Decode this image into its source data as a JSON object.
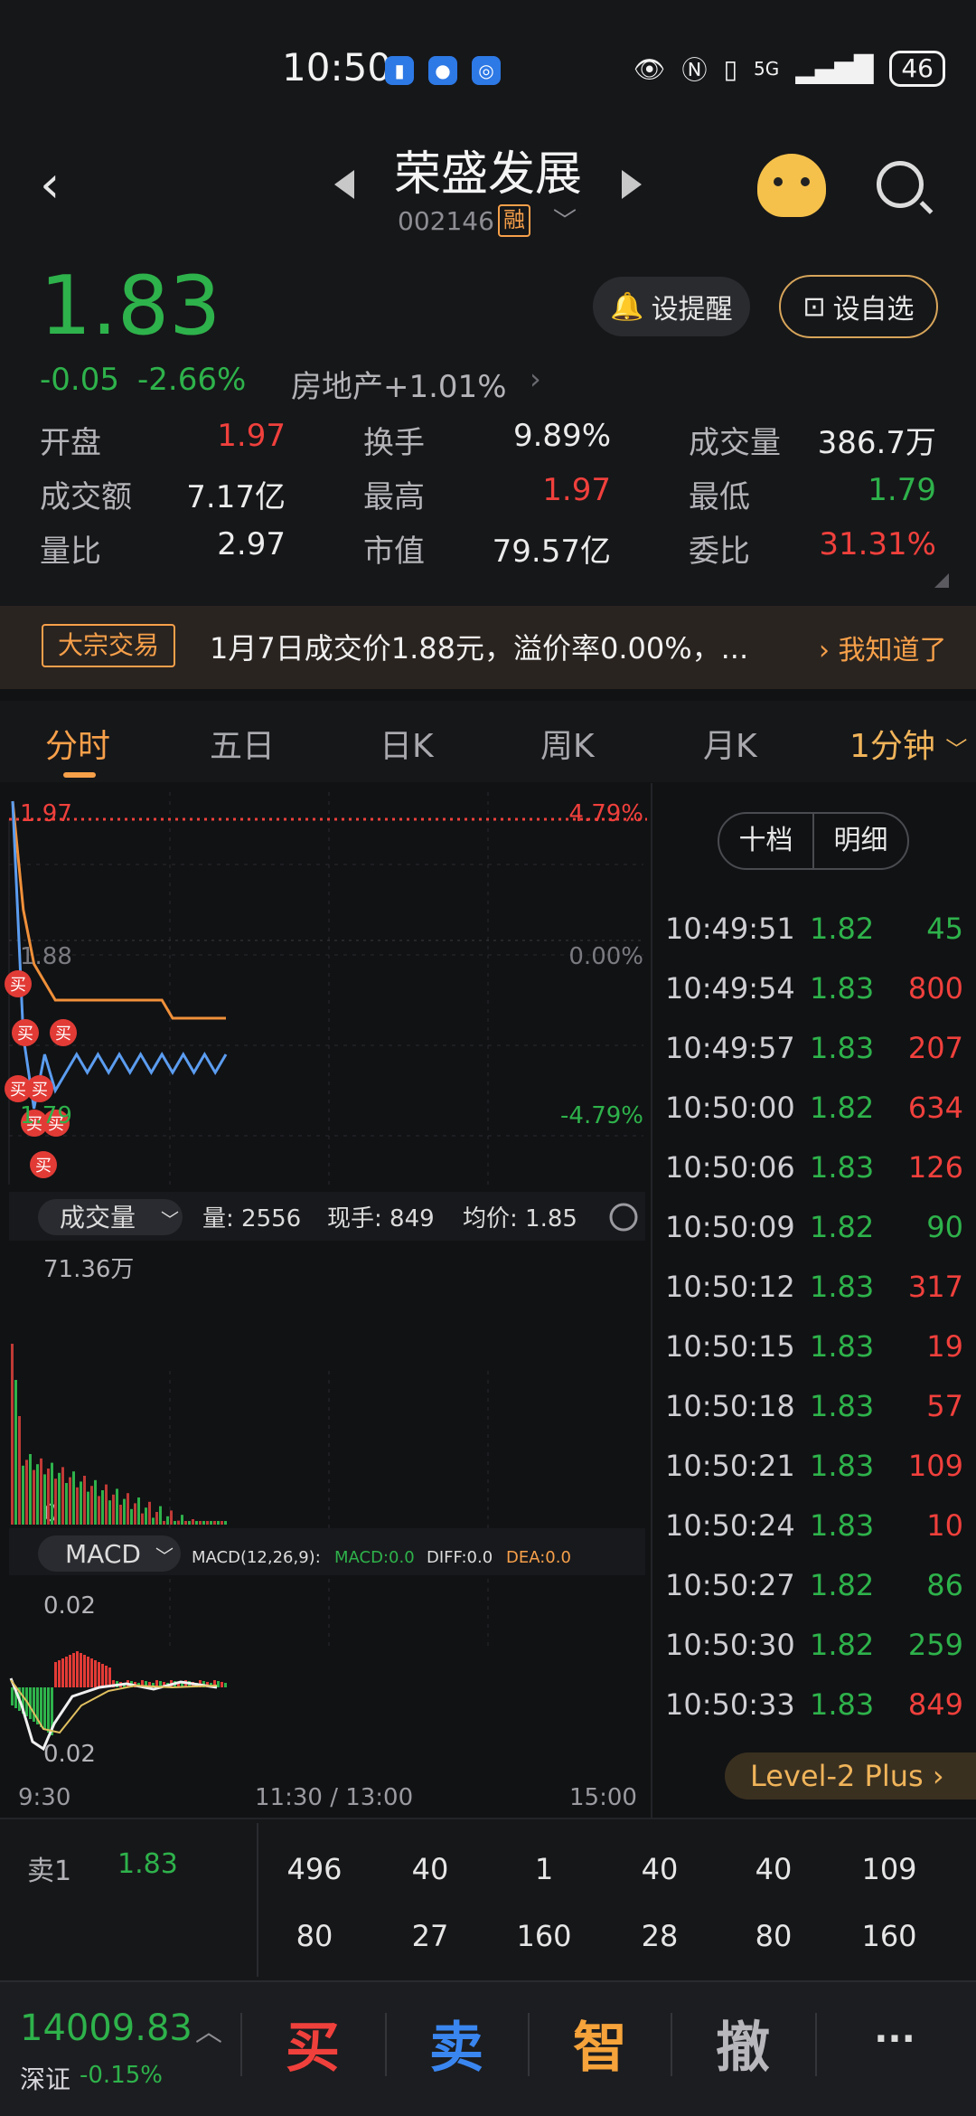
{
  "status_bar": {
    "time": "10:50",
    "network": "5G",
    "battery": "46"
  },
  "header": {
    "stock_name": "荣盛发展",
    "stock_code": "002146",
    "margin_badge": "融"
  },
  "quote": {
    "price": "1.83",
    "change": "-0.05",
    "change_pct": "-2.66%",
    "sector": "房地产+1.01%",
    "alert_label": "设提醒",
    "watchlist_label": "设自选",
    "stats": [
      {
        "label": "开盘",
        "value": "1.97",
        "color": "#f0403c"
      },
      {
        "label": "换手",
        "value": "9.89%",
        "color": "#ececec"
      },
      {
        "label": "成交量",
        "value": "386.7万",
        "color": "#ececec"
      },
      {
        "label": "成交额",
        "value": "7.17亿",
        "color": "#ececec"
      },
      {
        "label": "最高",
        "value": "1.97",
        "color": "#f0403c"
      },
      {
        "label": "最低",
        "value": "1.79",
        "color": "#2eb24b"
      },
      {
        "label": "量比",
        "value": "2.97",
        "color": "#ececec"
      },
      {
        "label": "市值",
        "value": "79.57亿",
        "color": "#ececec"
      },
      {
        "label": "委比",
        "value": "31.31%",
        "color": "#f0403c"
      }
    ]
  },
  "banner": {
    "tag": "大宗交易",
    "text": "1月7日成交价1.88元，溢价率0.00%，...",
    "ack": "我知道了"
  },
  "tabs": [
    {
      "label": "分时",
      "active": true
    },
    {
      "label": "五日"
    },
    {
      "label": "日K"
    },
    {
      "label": "周K"
    },
    {
      "label": "月K"
    },
    {
      "label": "1分钟"
    }
  ],
  "chart": {
    "price_high": "1.97",
    "price_mid": "1.88",
    "price_low": "1.79",
    "pct_high": "4.79%",
    "pct_mid": "0.00%",
    "pct_low": "-4.79%",
    "volume_selector": "成交量",
    "volume_info": {
      "vol": "量: 2556",
      "current": "现手: 849",
      "avg": "均价: 1.85"
    },
    "volume_max": "71.36万",
    "volume_zero": "0",
    "macd_selector": "MACD",
    "macd_params": "MACD(12,26,9):",
    "macd_value": "MACD:0.0",
    "diff_value": "DIFF:0.0",
    "dea_value": "DEA:0.0",
    "macd_top": "0.02",
    "macd_bottom": "0.02",
    "time_labels": [
      "9:30",
      "11:30 / 13:00",
      "15:00"
    ],
    "buy_marker": "买"
  },
  "chart_data": {
    "type": "line",
    "title": "",
    "x": [
      0,
      1,
      2,
      3,
      4,
      5,
      6,
      7,
      8,
      9,
      10,
      11,
      12,
      13,
      14,
      15,
      16,
      17,
      18,
      19,
      20
    ],
    "ylim": [
      1.79,
      1.97
    ],
    "series": [
      {
        "values": [
          1.97,
          1.84,
          1.8,
          1.83,
          1.81,
          1.82,
          1.83,
          1.82,
          1.83,
          1.82,
          1.83,
          1.82,
          1.83,
          1.82,
          1.83,
          1.82,
          1.83,
          1.82,
          1.83,
          1.82,
          1.83
        ]
      },
      {
        "values": [
          1.97,
          1.91,
          1.88,
          1.87,
          1.86,
          1.86,
          1.86,
          1.86,
          1.86,
          1.86,
          1.86,
          1.86,
          1.86,
          1.86,
          1.86,
          1.85,
          1.85,
          1.85,
          1.85,
          1.85,
          1.85
        ]
      }
    ]
  },
  "trades": [
    {
      "time": "10:49:51",
      "price": "1.82",
      "vol": "45",
      "color": "#2eb24b"
    },
    {
      "time": "10:49:54",
      "price": "1.83",
      "vol": "800",
      "color": "#f0403c"
    },
    {
      "time": "10:49:57",
      "price": "1.83",
      "vol": "207",
      "color": "#f0403c"
    },
    {
      "time": "10:50:00",
      "price": "1.82",
      "vol": "634",
      "color": "#f0403c"
    },
    {
      "time": "10:50:06",
      "price": "1.83",
      "vol": "126",
      "color": "#f0403c"
    },
    {
      "time": "10:50:09",
      "price": "1.82",
      "vol": "90",
      "color": "#2eb24b"
    },
    {
      "time": "10:50:12",
      "price": "1.83",
      "vol": "317",
      "color": "#f0403c"
    },
    {
      "time": "10:50:15",
      "price": "1.83",
      "vol": "19",
      "color": "#f0403c"
    },
    {
      "time": "10:50:18",
      "price": "1.83",
      "vol": "57",
      "color": "#f0403c"
    },
    {
      "time": "10:50:21",
      "price": "1.83",
      "vol": "109",
      "color": "#f0403c"
    },
    {
      "time": "10:50:24",
      "price": "1.83",
      "vol": "10",
      "color": "#f0403c"
    },
    {
      "time": "10:50:27",
      "price": "1.82",
      "vol": "86",
      "color": "#2eb24b"
    },
    {
      "time": "10:50:30",
      "price": "1.82",
      "vol": "259",
      "color": "#2eb24b"
    },
    {
      "time": "10:50:33",
      "price": "1.83",
      "vol": "849",
      "color": "#f0403c"
    }
  ],
  "trade_panel": {
    "toggle": [
      "十档",
      "明细"
    ],
    "level2": "Level-2 Plus"
  },
  "order_book": {
    "label": "卖1",
    "price": "1.83",
    "row1": [
      "496",
      "40",
      "1",
      "40",
      "40",
      "109"
    ],
    "row2": [
      "80",
      "27",
      "160",
      "28",
      "80",
      "160"
    ]
  },
  "bottom_bar": {
    "index_value": "14009.83",
    "index_name": "深证",
    "index_change": "-0.15%",
    "buy": "买",
    "sell": "卖",
    "smart": "智",
    "cancel": "撤",
    "more": "···"
  }
}
